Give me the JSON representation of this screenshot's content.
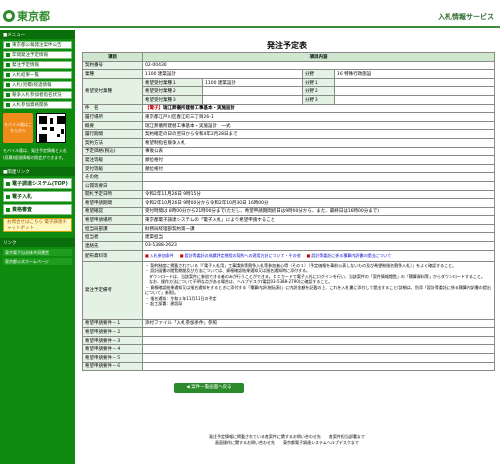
{
  "header": {
    "logo_text": "東京都",
    "title": "入札情報サービス"
  },
  "sidebar": {
    "menu_head": "■メニュー",
    "items": [
      {
        "label": "東京都公報発注案件公告"
      },
      {
        "label": "年間発注予定情報"
      },
      {
        "label": "発注予定情報"
      },
      {
        "label": "入札結果一覧"
      },
      {
        "label": "入札(見積)経過情報"
      },
      {
        "label": "競争入札参加者指名状況"
      },
      {
        "label": "入札参加資格関係"
      }
    ],
    "mobile_btn": "モバイル版はこちらから",
    "mobile_note": "モバイル版は、発注予定情報と入札(見積)経過情報の照会ができます。",
    "links_head": "■関連リンク",
    "big_links": [
      {
        "label": "電子調達システム(TOP)"
      },
      {
        "label": "電子入札"
      },
      {
        "label": "資格審査"
      }
    ],
    "chat_label": "お問合せはこちら 電子調達チャットボット",
    "footer_links_head": "リンク",
    "footer_links": [
      {
        "label": "東京電子自治体共同運営"
      },
      {
        "label": "東京都公式ホームページ"
      }
    ]
  },
  "main": {
    "page_title": "発注予定表",
    "col_item": "項目",
    "col_content": "項目内容",
    "rows": {
      "contract_no": {
        "label": "契約番号",
        "value": "02-00430"
      },
      "industry": {
        "label": "業種",
        "value": "1100 建築設計",
        "bunya_label": "分野",
        "bunya_value": "16 特殊行政施設"
      },
      "desired": {
        "label": "希望受付業種",
        "lines": [
          {
            "label": "希望受付業種１",
            "value": "1100 建築設計",
            "extra": "1100 建築設計",
            "bunya": "分野１"
          },
          {
            "label": "希望受付業種２",
            "value": "",
            "bunya": "分野２"
          },
          {
            "label": "希望受付業種３",
            "value": "",
            "bunya": "分野３"
          }
        ]
      },
      "title": {
        "label": "件　名",
        "tag": "【電子】",
        "value": "瑞江葬儀所建替工事基本・実施設計"
      },
      "location": {
        "label": "履行場所",
        "value": "東京都江戸川区春江町三丁目26-1"
      },
      "summary": {
        "label": "概要",
        "value": "瑞江葬儀所建替工事基本・実施設計　一式"
      },
      "period": {
        "label": "履行期間",
        "value": "契約確定の日の翌日から令和4年2月28日まで"
      },
      "method": {
        "label": "契約方法",
        "value": "希望制指名競争入札"
      },
      "price": {
        "label": "予定価格(税込)",
        "value": "事後公表"
      },
      "order_date": {
        "label": "発注等級",
        "value": "順位格付"
      },
      "receipt": {
        "label": "受付等級",
        "value": "順位格付"
      },
      "other": {
        "label": "その他",
        "value": ""
      },
      "announce": {
        "label": "公開等要日",
        "value": ""
      },
      "open_date": {
        "label": "開札予定日時",
        "value": "令和2年11月26日 9時15分"
      },
      "apply_period": {
        "label": "希望申請期間",
        "value": "令和2年10月26日 9時00分から令和2年10月30日 16時00分"
      },
      "apply_note": {
        "label": "希望確認",
        "value": "受付時間は 8時00分から21時00分まで(ただし、希望申請期間初日は9時00分から、また、最終日は16時00分まで)"
      },
      "apply_method": {
        "label": "希望申請場所",
        "value": "東京都電子調達システムの「電子入札」により希望申請すること"
      },
      "dept": {
        "label": "担当局部課",
        "value": "財務局経理部契約第一課"
      },
      "person": {
        "label": "担当者",
        "value": "建築担当"
      },
      "tel": {
        "label": "連絡先",
        "value": "03-5388-2623"
      },
      "docs": {
        "label": "配布資料等",
        "files": [
          "入札参加条件",
          "設計等委託の成績評定規程の契約への適用方針について・その他",
          "設計等委託に係る積算内訳書の提出について"
        ]
      },
      "notes": {
        "label": "発注予定備考",
        "value": "・ 契約制度に掲載されている『「電子入札用」工事請負等競争入札等参加者心得（その１）（予定価格を事前公表しないもの及び希望制指名競争入札）』をよく確認すること。\n・ 設計図書の閲覧期間及び方法については、資格確認結果通知又は指名通知時に添付する。\n　ダウンロードは、当該案件に参加できる者のみが行うことができる。ＩＣカードで電子入札にログインを行い、当該案件の「案件情報閲覧」の「積算資料等」からダウンロードすること。\n　なお、操作方法について不明な点がある場合は、ヘルプデスク(電話03-5388-2790)に確認すること。\n・ 資格確認結果通知又は指名通知をするときに添付する「積算内訳(総括表)」に内訳金額を記載の上、これを入札書に添付して提出すること(詳細は、別添「設計等委託に係る積算内訳書の提出について」参照)。\n・ 指名通知：令和２年11月11日の予定\n・ 起工部署：建設局"
      },
      "cond1": {
        "label": "希望申請要件－１",
        "value": "添付ファイル「入札参加条件」参照"
      },
      "cond2": {
        "label": "希望申請要件－２",
        "value": ""
      },
      "cond3": {
        "label": "希望申請要件－３",
        "value": ""
      },
      "cond4": {
        "label": "希望申請要件－４",
        "value": ""
      },
      "cond5": {
        "label": "希望申請要件－５",
        "value": ""
      },
      "cond6": {
        "label": "希望申請要件－６",
        "value": ""
      }
    },
    "back_button": "◀ 案件一覧画面へ戻る"
  },
  "footer": {
    "line1": "発注予定情報に掲載されている各案件に関するお問い合わせ先　　各案件担当部署まで",
    "line2": "画面操作に関するお問い合わせ先　　東京都電子調達システムヘルプデスクまで"
  }
}
